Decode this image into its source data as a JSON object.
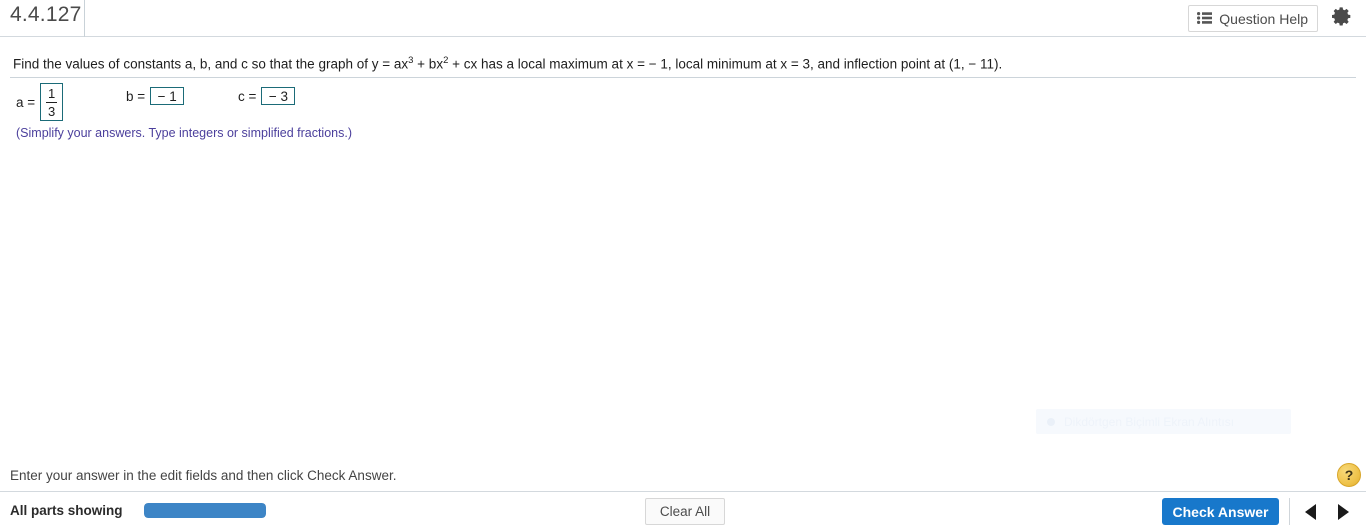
{
  "header": {
    "exercise_id": "4.4.127",
    "question_help_label": "Question Help",
    "question_help_icon": "bulleted-list-icon",
    "settings_icon": "gear-icon"
  },
  "question": {
    "text_part_1": "Find the values of constants a, b, and c so that the graph of y = ax",
    "sup_1": "3",
    "text_part_2": " + bx",
    "sup_2": "2",
    "text_part_3": " + cx has a local maximum at x = − 1, local minimum at x = 3, and inflection point at (1, − 11)."
  },
  "answers": {
    "a": {
      "label": "a =",
      "value_numerator": "1",
      "value_denominator": "3",
      "is_fraction": true
    },
    "b": {
      "label": "b =",
      "value": "− 1"
    },
    "c": {
      "label": "c =",
      "value": "− 3"
    },
    "simplify_note": "(Simplify your answers. Type integers or simplified fractions.)",
    "note_color": "#4b3f9c",
    "field_border_color": "#1b6b78"
  },
  "watermark": {
    "label": "Dikdörtgen Biçimli Ekran Alıntısı"
  },
  "footer": {
    "hint": "Enter your answer in the edit fields and then click Check Answer.",
    "parts_label": "All parts showing",
    "progress_percent": 100,
    "progress_color": "#3d85c6",
    "clear_all_label": "Clear All",
    "check_answer_label": "Check Answer",
    "check_answer_color": "#1878cb",
    "help_fab_label": "?",
    "prev_icon": "triangle-left-icon",
    "next_icon": "triangle-right-icon"
  }
}
